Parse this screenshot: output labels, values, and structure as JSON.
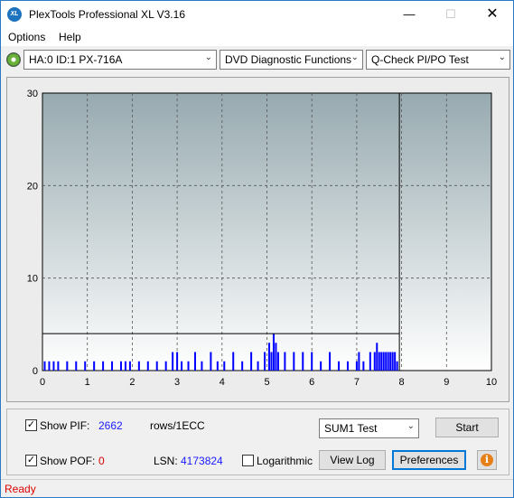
{
  "window": {
    "title": "PlexTools Professional XL V3.16",
    "icon_text": "XL"
  },
  "title_buttons": {
    "minimize": "—",
    "maximize": "☐",
    "close": "✕"
  },
  "menu": {
    "options": "Options",
    "help": "Help"
  },
  "toolbar": {
    "drive": "HA:0 ID:1  PX-716A",
    "function": "DVD Diagnostic Functions",
    "test": "Q-Check PI/PO Test",
    "arrow": "⌄"
  },
  "chart_data": {
    "type": "bar",
    "x_ticks": [
      "0",
      "1",
      "2",
      "3",
      "4",
      "5",
      "6",
      "7",
      "8",
      "9",
      "10"
    ],
    "y_ticks": [
      "0",
      "10",
      "20",
      "30"
    ],
    "xlim": [
      0,
      10
    ],
    "ylim": [
      0,
      30
    ],
    "grid": true,
    "threshold_line": 4,
    "scan_end_x": 7.95,
    "series": [
      {
        "values_description": "",
        "x": [
          0.05,
          0.15,
          0.25,
          0.35,
          0.55,
          0.75,
          0.95,
          1.15,
          1.35,
          1.55,
          1.75,
          1.85,
          1.95,
          2.15,
          2.35,
          2.55,
          2.75,
          2.9,
          3.0,
          3.1,
          3.25,
          3.4,
          3.55,
          3.75,
          3.9,
          4.05,
          4.25,
          4.45,
          4.65,
          4.8,
          4.95,
          5.05,
          5.1,
          5.15,
          5.2,
          5.25,
          5.4,
          5.6,
          5.8,
          6.0,
          6.2,
          6.4,
          6.6,
          6.8,
          7.0,
          7.05,
          7.15,
          7.3,
          7.4,
          7.45,
          7.5,
          7.55,
          7.6,
          7.65,
          7.7,
          7.75,
          7.8,
          7.85,
          7.9
        ],
        "y": [
          1,
          1,
          1,
          1,
          1,
          1,
          1,
          1,
          1,
          1,
          1,
          1,
          1,
          1,
          1,
          1,
          1,
          2,
          2,
          1,
          1,
          2,
          1,
          2,
          1,
          1,
          2,
          1,
          2,
          1,
          2,
          3,
          2,
          4,
          3,
          2,
          2,
          2,
          2,
          2,
          1,
          2,
          1,
          1,
          1,
          2,
          1,
          2,
          2,
          3,
          2,
          2,
          2,
          2,
          2,
          2,
          2,
          2,
          1
        ]
      }
    ]
  },
  "bottom": {
    "show_pif_label": "Show PIF:",
    "pif_value": "2662",
    "pif_units": "rows/1ECC",
    "show_pof_label": "Show POF:",
    "pof_value": "0",
    "lsn_label": "LSN:",
    "lsn_value": "4173824",
    "logarithmic_label": "Logarithmic",
    "sum_test": "SUM1 Test",
    "start": "Start",
    "view_log": "View Log",
    "preferences": "Preferences",
    "info": "i",
    "check": "✓"
  },
  "status": {
    "text": "Ready"
  },
  "colors": {
    "bar": "#0000ff",
    "accent": "#0078d7",
    "status_red": "#dd0000"
  }
}
